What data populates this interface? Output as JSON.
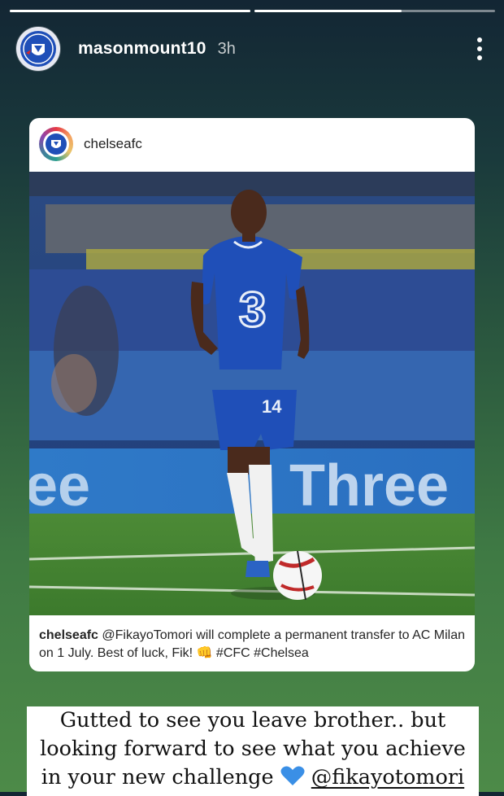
{
  "story": {
    "progress": [
      1.0,
      0.61
    ],
    "username": "masonmount10",
    "time": "3h"
  },
  "post": {
    "account": "chelseafc",
    "caption_user": "chelseafc",
    "caption_text": "@FikayoTomori will complete a permanent transfer to AC Milan on 1 July. Best of luck, Fik! 👊 #CFC #Chelsea",
    "board_text": "Three",
    "shirt_number": "14"
  },
  "message": {
    "line1": "Gutted to see you leave brother.. but",
    "line2": "looking forward to see what you achieve",
    "line3_prefix": "in your new challenge",
    "line3_mention": "@fikayotomori"
  },
  "icons": {
    "more": "more-vertical-icon",
    "heart": "blue-heart-icon",
    "avatar": "chelsea-crest-icon"
  },
  "colors": {
    "chelsea_blue": "#1f4fb8",
    "heart_blue": "#3a8fe6"
  }
}
